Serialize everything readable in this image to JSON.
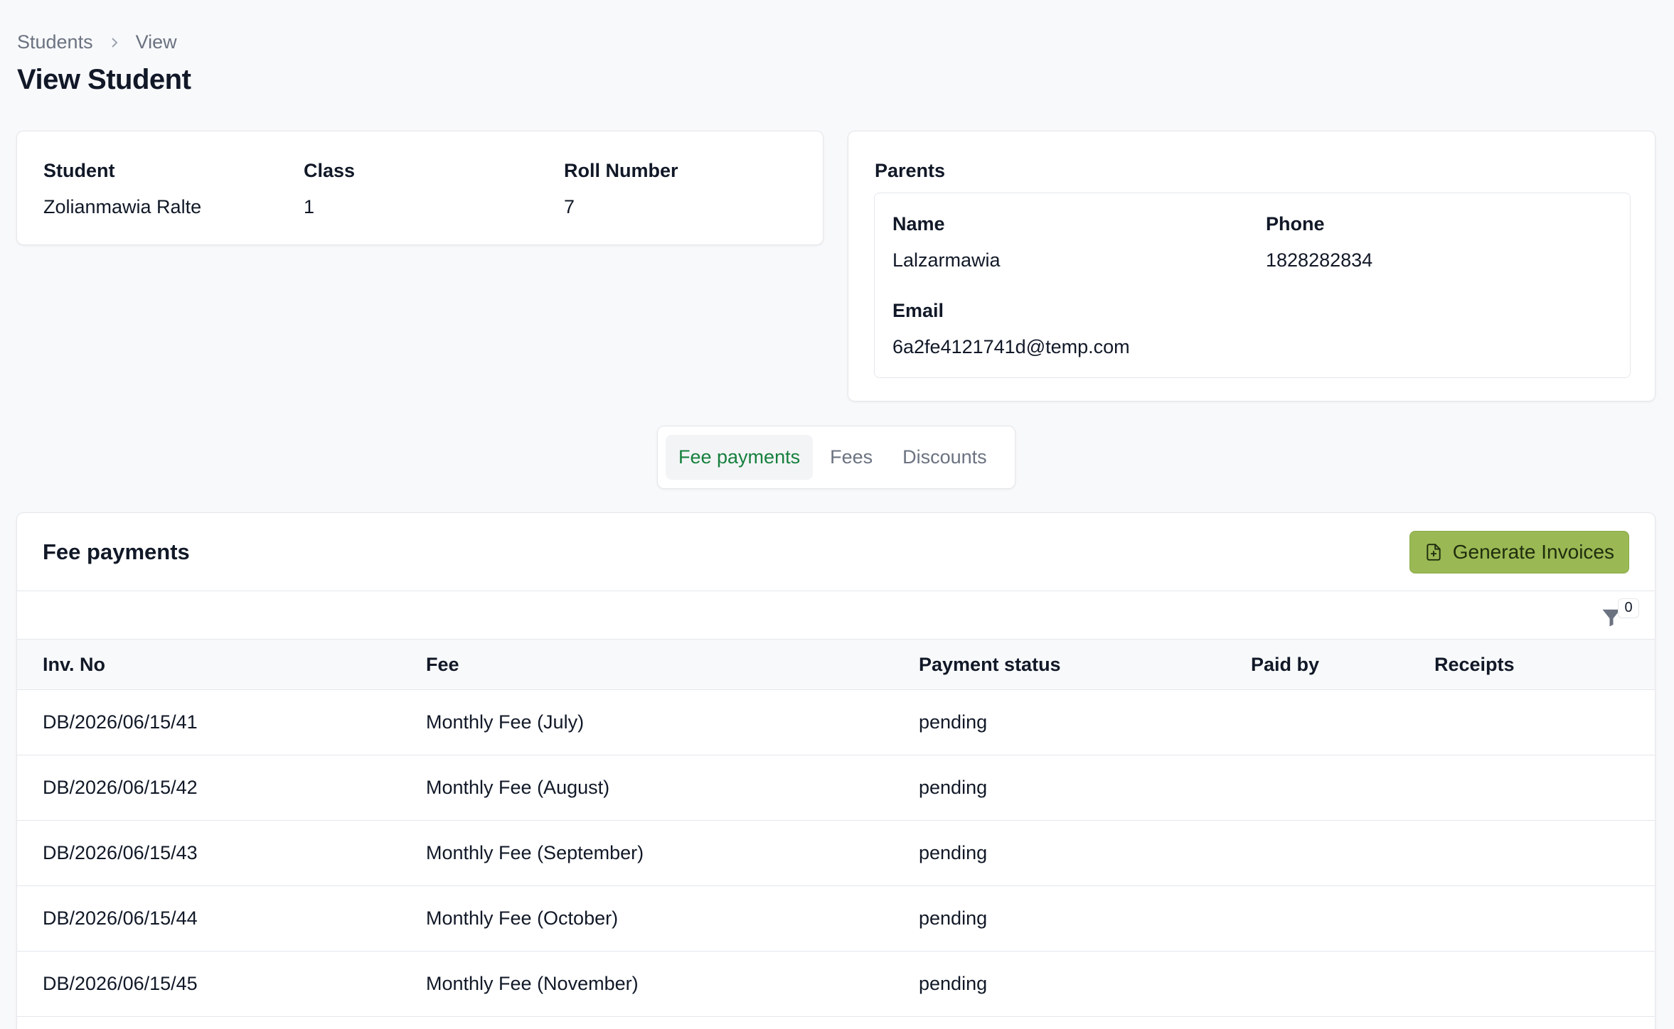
{
  "breadcrumb": {
    "items": [
      "Students",
      "View"
    ]
  },
  "page_title": "View Student",
  "student": {
    "labels": {
      "student": "Student",
      "class": "Class",
      "roll": "Roll Number"
    },
    "values": {
      "student": "Zolianmawia Ralte",
      "class": "1",
      "roll": "7"
    }
  },
  "parents": {
    "title": "Parents",
    "labels": {
      "name": "Name",
      "phone": "Phone",
      "email": "Email"
    },
    "values": {
      "name": "Lalzarmawia",
      "phone": "1828282834",
      "email": "6a2fe4121741d@temp.com"
    }
  },
  "tabs": [
    {
      "label": "Fee payments",
      "active": true
    },
    {
      "label": "Fees",
      "active": false
    },
    {
      "label": "Discounts",
      "active": false
    }
  ],
  "fee_payments": {
    "title": "Fee payments",
    "generate_button": "Generate Invoices",
    "filter_count": "0",
    "columns": [
      "Inv. No",
      "Fee",
      "Payment status",
      "Paid by",
      "Receipts"
    ],
    "rows": [
      {
        "inv": "DB/2026/06/15/41",
        "fee": "Monthly Fee (July)",
        "status": "pending",
        "paid_by": "",
        "receipts": ""
      },
      {
        "inv": "DB/2026/06/15/42",
        "fee": "Monthly Fee (August)",
        "status": "pending",
        "paid_by": "",
        "receipts": ""
      },
      {
        "inv": "DB/2026/06/15/43",
        "fee": "Monthly Fee (September)",
        "status": "pending",
        "paid_by": "",
        "receipts": ""
      },
      {
        "inv": "DB/2026/06/15/44",
        "fee": "Monthly Fee (October)",
        "status": "pending",
        "paid_by": "",
        "receipts": ""
      },
      {
        "inv": "DB/2026/06/15/45",
        "fee": "Monthly Fee (November)",
        "status": "pending",
        "paid_by": "",
        "receipts": ""
      }
    ]
  },
  "colors": {
    "accent_green": "#15803d",
    "button_bg": "#9ab854",
    "icon_gray": "#6b7280"
  }
}
